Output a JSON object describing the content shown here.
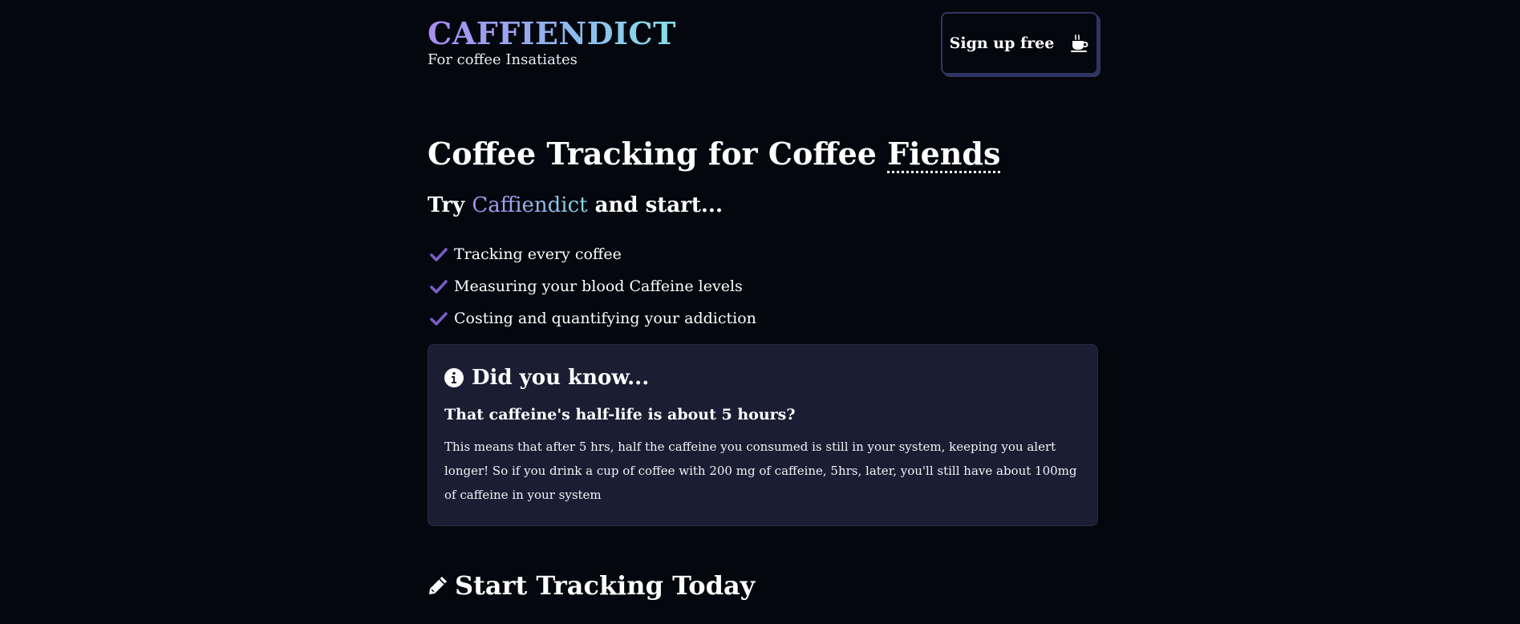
{
  "brand": {
    "name": "CAFFIENDICT",
    "tagline": "For coffee Insatiates"
  },
  "header": {
    "signup_label": "Sign up free",
    "signup_icon": "coffee-cup-icon"
  },
  "hero": {
    "title_prefix": "Coffee Tracking for Coffee ",
    "title_highlight": "Fiends",
    "try_prefix": "Try ",
    "try_brand": "Caffiendict",
    "try_suffix": " and start..."
  },
  "features": [
    {
      "label": "Tracking every coffee",
      "icon": "check-icon"
    },
    {
      "label": "Measuring your blood Caffeine levels",
      "icon": "check-icon"
    },
    {
      "label": "Costing and quantifying your addiction",
      "icon": "check-icon"
    }
  ],
  "info": {
    "icon": "info-circle-icon",
    "title": "Did you know...",
    "question": "That caffeine's half-life is about 5 hours?",
    "body": "This means that after 5 hrs, half the caffeine you consumed is still in your system, keeping you alert longer! So if you drink a cup of coffee with 200 mg of caffeine, 5hrs, later, you'll still have about 100mg of caffeine in your system"
  },
  "start": {
    "icon": "pencil-icon",
    "title": "Start Tracking Today"
  },
  "colors": {
    "background": "#05070e",
    "card": "#1b1e33",
    "check": "#7b5cc4",
    "brand_gradient_start": "#a88cf0",
    "brand_gradient_end": "#86e0e6"
  }
}
